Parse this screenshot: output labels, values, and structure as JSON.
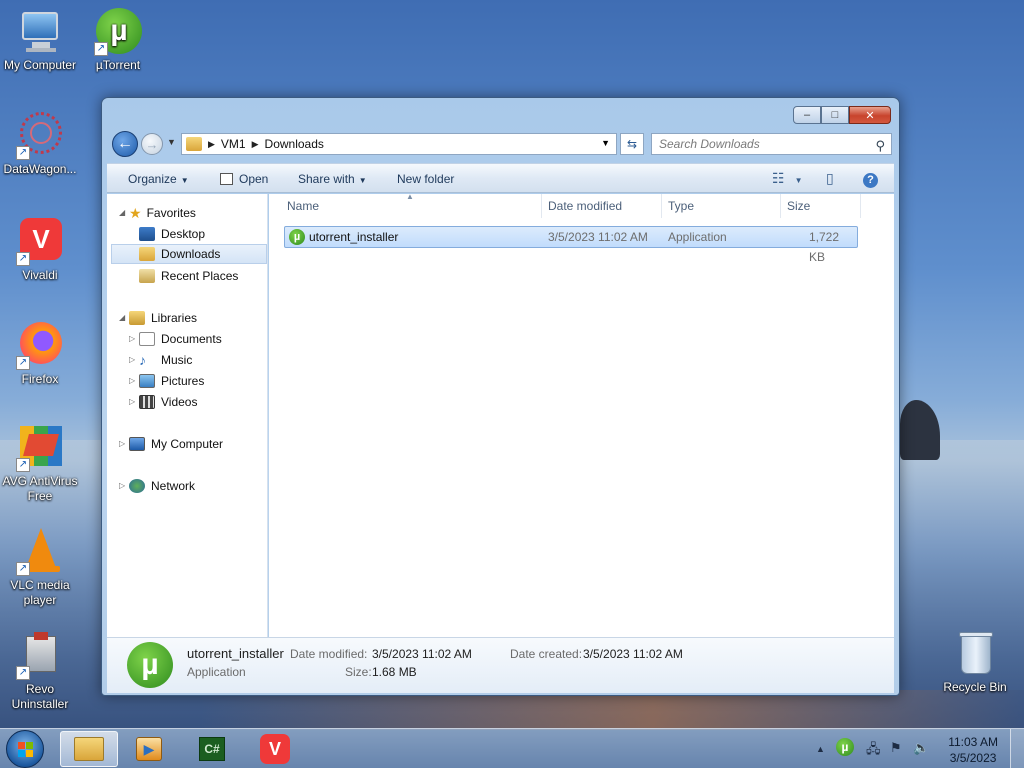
{
  "desktop": {
    "icons": [
      {
        "label": "My Computer",
        "icon": "computer-icon"
      },
      {
        "label": "µTorrent",
        "icon": "utorrent-icon"
      },
      {
        "label": "DataWagon...",
        "icon": "datawagon-icon"
      },
      {
        "label": "Vivaldi",
        "icon": "vivaldi-icon"
      },
      {
        "label": "Firefox",
        "icon": "firefox-icon"
      },
      {
        "label": "AVG AntiVirus Free",
        "icon": "avg-icon"
      },
      {
        "label": "VLC media player",
        "icon": "vlc-icon"
      },
      {
        "label": "Revo Uninstaller",
        "icon": "revo-icon"
      },
      {
        "label": "Recycle Bin",
        "icon": "recycle-bin-icon"
      }
    ]
  },
  "window": {
    "controls": {
      "minimize": "–",
      "maximize": "□",
      "close": "✕"
    },
    "address": {
      "segments": [
        "VM1",
        "Downloads"
      ]
    },
    "search": {
      "placeholder": "Search Downloads"
    },
    "toolbar": {
      "organize": "Organize",
      "open": "Open",
      "share_with": "Share with",
      "new_folder": "New folder"
    },
    "nav": {
      "favorites": "Favorites",
      "desktop": "Desktop",
      "downloads": "Downloads",
      "recent_places": "Recent Places",
      "libraries": "Libraries",
      "documents": "Documents",
      "music": "Music",
      "pictures": "Pictures",
      "videos": "Videos",
      "my_computer": "My Computer",
      "network": "Network"
    },
    "columns": {
      "name": "Name",
      "date_modified": "Date modified",
      "type": "Type",
      "size": "Size"
    },
    "files": [
      {
        "name": "utorrent_installer",
        "date_modified": "3/5/2023 11:02 AM",
        "type": "Application",
        "size": "1,722 KB"
      }
    ],
    "details": {
      "name": "utorrent_installer",
      "type": "Application",
      "date_modified_label": "Date modified:",
      "date_modified": "3/5/2023 11:02 AM",
      "size_label": "Size:",
      "size": "1.68 MB",
      "date_created_label": "Date created:",
      "date_created": "3/5/2023 11:02 AM"
    }
  },
  "taskbar": {
    "clock_time": "11:03 AM",
    "clock_date": "3/5/2023",
    "apps": [
      "windows-explorer-icon",
      "media-player-icon",
      "csharp-icon",
      "vivaldi-icon"
    ]
  }
}
